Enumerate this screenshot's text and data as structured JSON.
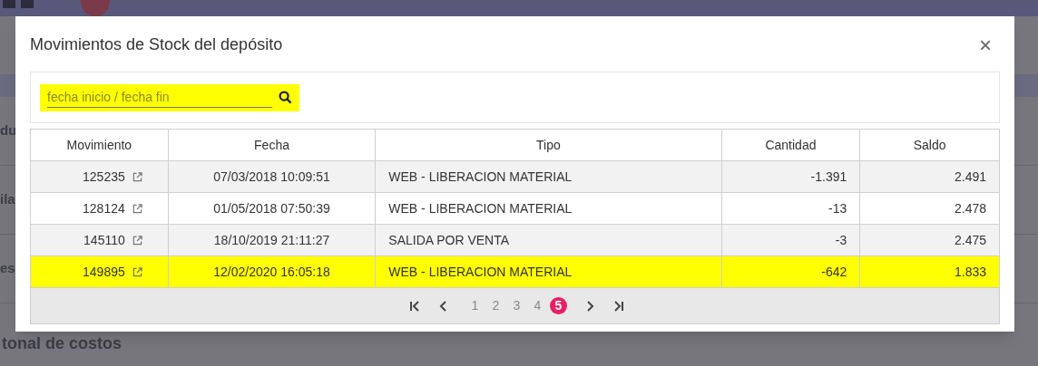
{
  "background": {
    "items": [
      {
        "label": "du"
      },
      {
        "label": "ila"
      },
      {
        "label": "es"
      },
      {
        "label": "tonal de costos"
      }
    ]
  },
  "dialog": {
    "title": "Movimientos de Stock del depósito",
    "close": "×"
  },
  "search": {
    "placeholder": "fecha inicio / fecha fin",
    "highlighted": true
  },
  "table": {
    "columns": [
      "Movimiento",
      "Fecha",
      "Tipo",
      "Cantidad",
      "Saldo"
    ],
    "rows": [
      {
        "movimiento": "125235",
        "fecha": "07/03/2018 10:09:51",
        "tipo": "WEB - LIBERACION MATERIAL",
        "cantidad": "-1.391",
        "saldo": "2.491",
        "highlighted": false
      },
      {
        "movimiento": "128124",
        "fecha": "01/05/2018 07:50:39",
        "tipo": "WEB - LIBERACION MATERIAL",
        "cantidad": "-13",
        "saldo": "2.478",
        "highlighted": false
      },
      {
        "movimiento": "145110",
        "fecha": "18/10/2019 21:11:27",
        "tipo": "SALIDA POR VENTA",
        "cantidad": "-3",
        "saldo": "2.475",
        "highlighted": false
      },
      {
        "movimiento": "149895",
        "fecha": "12/02/2020 16:05:18",
        "tipo": "WEB - LIBERACION MATERIAL",
        "cantidad": "-642",
        "saldo": "1.833",
        "highlighted": true
      }
    ]
  },
  "pager": {
    "pages": [
      {
        "label": "1",
        "selected": false
      },
      {
        "label": "2",
        "selected": false
      },
      {
        "label": "3",
        "selected": false
      },
      {
        "label": "4",
        "selected": false
      },
      {
        "label": "5",
        "selected": true
      }
    ]
  }
}
